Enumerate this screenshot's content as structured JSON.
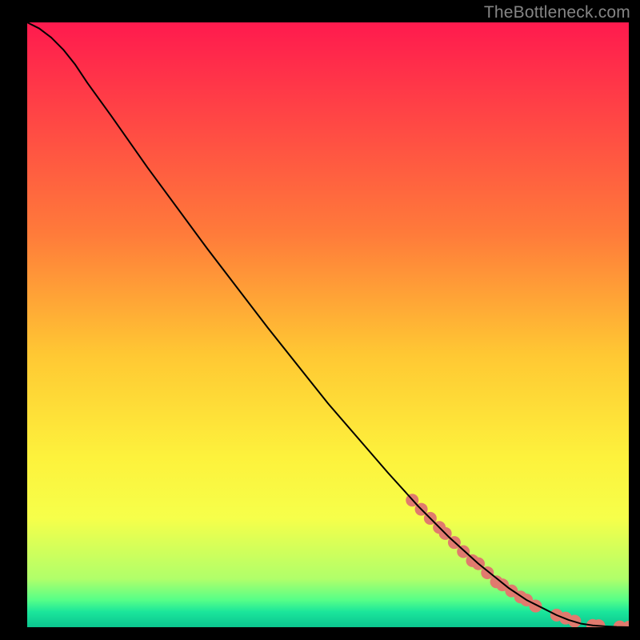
{
  "watermark": "TheBottleneck.com",
  "chart_data": {
    "type": "line",
    "title": "",
    "xlabel": "",
    "ylabel": "",
    "xlim": [
      0,
      100
    ],
    "ylim": [
      0,
      100
    ],
    "legend": false,
    "grid": false,
    "background_gradient": [
      {
        "offset": 0.0,
        "color": "#ff1a4e"
      },
      {
        "offset": 0.35,
        "color": "#ff7b3a"
      },
      {
        "offset": 0.55,
        "color": "#ffc833"
      },
      {
        "offset": 0.72,
        "color": "#fdf23c"
      },
      {
        "offset": 0.82,
        "color": "#f6ff4a"
      },
      {
        "offset": 0.92,
        "color": "#b0ff6a"
      },
      {
        "offset": 0.955,
        "color": "#56ff88"
      },
      {
        "offset": 0.975,
        "color": "#1ae59b"
      },
      {
        "offset": 1.0,
        "color": "#0bc58f"
      }
    ],
    "series": [
      {
        "name": "bottleneck-curve",
        "color": "#000000",
        "stroke_width": 2,
        "x": [
          0.0,
          2.0,
          4.0,
          6.0,
          8.0,
          10.0,
          14.0,
          20.0,
          30.0,
          40.0,
          50.0,
          60.0,
          65.0,
          70.0,
          75.0,
          80.0,
          83.0,
          86.0,
          88.0,
          90.0,
          92.0,
          94.0,
          96.0,
          98.0,
          100.0
        ],
        "y": [
          100.0,
          99.0,
          97.5,
          95.5,
          93.0,
          90.0,
          84.5,
          76.0,
          62.5,
          49.5,
          37.0,
          25.5,
          20.0,
          15.0,
          10.5,
          6.5,
          4.5,
          3.0,
          2.0,
          1.2,
          0.6,
          0.3,
          0.15,
          0.05,
          0.0
        ]
      },
      {
        "name": "highlighted-data-points",
        "type": "scatter",
        "color": "#e07a6e",
        "radius": 8,
        "x": [
          64.0,
          65.5,
          67.0,
          68.5,
          69.5,
          71.0,
          72.5,
          74.0,
          75.0,
          76.5,
          78.0,
          79.0,
          80.5,
          82.0,
          83.0,
          84.5,
          88.0,
          89.5,
          91.0,
          94.0,
          95.0,
          98.5,
          100.0
        ],
        "y": [
          21.0,
          19.5,
          18.0,
          16.5,
          15.5,
          14.0,
          12.5,
          11.0,
          10.5,
          9.0,
          7.5,
          7.0,
          6.0,
          5.0,
          4.5,
          3.5,
          2.0,
          1.5,
          1.0,
          0.3,
          0.25,
          0.05,
          0.0
        ]
      }
    ]
  }
}
